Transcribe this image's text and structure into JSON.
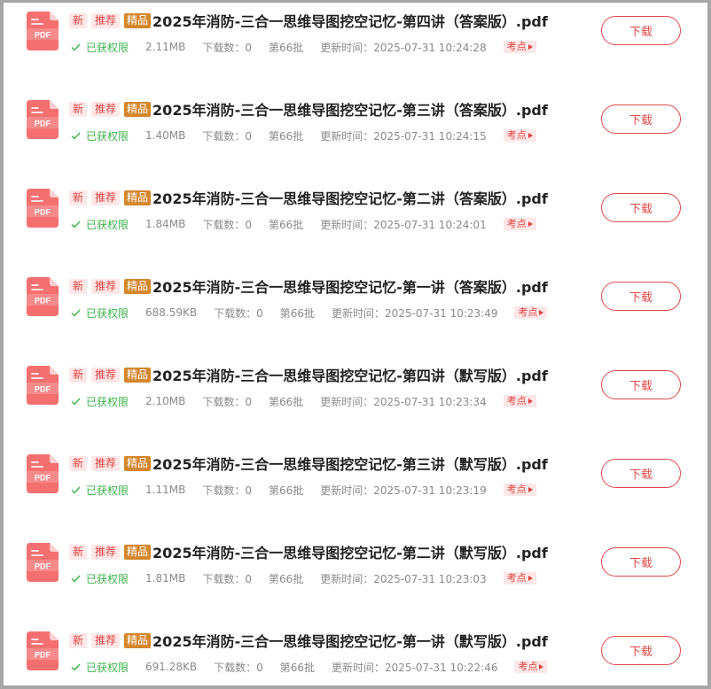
{
  "tags": {
    "new": "新",
    "recommend": "推荐",
    "fine": "精品"
  },
  "permission_label": "已获权限",
  "download_label": "下载",
  "point_label": "考点",
  "colors": {
    "tag_red": "#e04040",
    "tag_red_bg": "#fde7e7",
    "tag_gold": "#d4862b",
    "permission_green": "#3db24b",
    "button_red": "#e04848",
    "pdf_icon": "#f06060"
  },
  "files": [
    {
      "title": "2025年消防-三合一思维导图挖空记忆-第四讲（答案版）.pdf",
      "size": "2.11MB",
      "downloads": "下载数：0",
      "batch": "第66批",
      "updated": "更新时间：2025-07-31 10:24:28"
    },
    {
      "title": "2025年消防-三合一思维导图挖空记忆-第三讲（答案版）.pdf",
      "size": "1.40MB",
      "downloads": "下载数：0",
      "batch": "第66批",
      "updated": "更新时间：2025-07-31 10:24:15"
    },
    {
      "title": "2025年消防-三合一思维导图挖空记忆-第二讲（答案版）.pdf",
      "size": "1.84MB",
      "downloads": "下载数：0",
      "batch": "第66批",
      "updated": "更新时间：2025-07-31 10:24:01"
    },
    {
      "title": "2025年消防-三合一思维导图挖空记忆-第一讲（答案版）.pdf",
      "size": "688.59KB",
      "downloads": "下载数：0",
      "batch": "第66批",
      "updated": "更新时间：2025-07-31 10:23:49"
    },
    {
      "title": "2025年消防-三合一思维导图挖空记忆-第四讲（默写版）.pdf",
      "size": "2.10MB",
      "downloads": "下载数：0",
      "batch": "第66批",
      "updated": "更新时间：2025-07-31 10:23:34"
    },
    {
      "title": "2025年消防-三合一思维导图挖空记忆-第三讲（默写版）.pdf",
      "size": "1.11MB",
      "downloads": "下载数：0",
      "batch": "第66批",
      "updated": "更新时间：2025-07-31 10:23:19"
    },
    {
      "title": "2025年消防-三合一思维导图挖空记忆-第二讲（默写版）.pdf",
      "size": "1.81MB",
      "downloads": "下载数：0",
      "batch": "第66批",
      "updated": "更新时间：2025-07-31 10:23:03"
    },
    {
      "title": "2025年消防-三合一思维导图挖空记忆-第一讲（默写版）.pdf",
      "size": "691.28KB",
      "downloads": "下载数：0",
      "batch": "第66批",
      "updated": "更新时间：2025-07-31 10:22:46"
    }
  ]
}
